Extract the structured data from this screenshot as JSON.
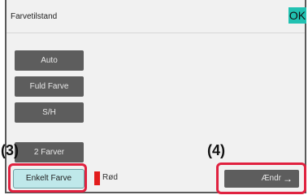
{
  "header": {
    "title": "Farvetilstand",
    "ok_label": "OK"
  },
  "modes": {
    "auto": "Auto",
    "full_color": "Fuld Farve",
    "bw": "S/H",
    "two_colors": "2 Farver",
    "single_color": "Enkelt Farve"
  },
  "selected_color": {
    "name": "Rød",
    "swatch": "#e21c1c"
  },
  "change_button": {
    "label": "Ændr",
    "icon": "arrow-right-icon"
  },
  "callouts": {
    "step3": "(3)",
    "step4": "(4)"
  },
  "colors": {
    "accent": "#21c1b1",
    "highlight": "#e0213f",
    "button": "#5d5d5d",
    "selected": "#bfe8ea"
  }
}
